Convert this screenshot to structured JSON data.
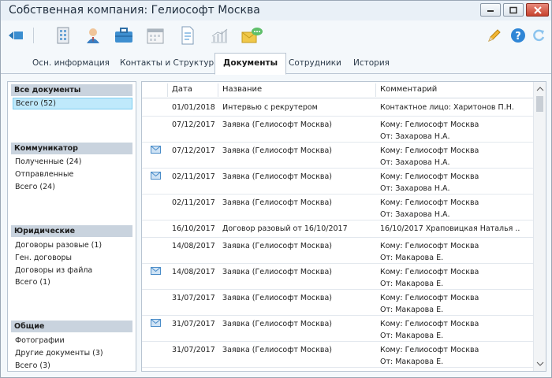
{
  "window": {
    "title": "Собственная компания: Гелиософт Москва"
  },
  "tabs": [
    {
      "label": "Осн. информация"
    },
    {
      "label": "Контакты и Структура"
    },
    {
      "label": "Документы"
    },
    {
      "label": "Сотрудники"
    },
    {
      "label": "История"
    }
  ],
  "active_tab": "Документы",
  "groups": [
    {
      "title": "Все документы",
      "items": [
        "Всего (52)"
      ]
    },
    {
      "title": "Коммуникатор",
      "items": [
        "Полученные (24)",
        "Отправленные",
        "Всего (24)"
      ]
    },
    {
      "title": "Юридические",
      "items": [
        "Договоры разовые (1)",
        "Ген. договоры",
        "Договоры из файла",
        "Всего (1)"
      ]
    },
    {
      "title": "Общие",
      "items": [
        "Фотографии",
        "Другие документы (3)",
        "Всего (3)"
      ]
    }
  ],
  "selected_item": "Всего (52)",
  "table": {
    "columns": [
      "Дата",
      "Название",
      "Комментарий"
    ],
    "rows": [
      {
        "mail": false,
        "date": "01/01/2018",
        "name": "Интервью с рекрутером",
        "comment": [
          "Контактное лицо: Харитонов П.Н."
        ]
      },
      {
        "mail": false,
        "date": "07/12/2017",
        "name": "Заявка (Гелиософт Москва)",
        "comment": [
          "Кому: Гелиософт Москва",
          "От: Захарова Н.А."
        ]
      },
      {
        "mail": true,
        "date": "07/12/2017",
        "name": "Заявка (Гелиософт Москва)",
        "comment": [
          "Кому: Гелиософт Москва",
          "От: Захарова Н.А."
        ]
      },
      {
        "mail": true,
        "date": "02/11/2017",
        "name": "Заявка (Гелиософт Москва)",
        "comment": [
          "Кому: Гелиософт Москва",
          "От: Захарова Н.А."
        ]
      },
      {
        "mail": false,
        "date": "02/11/2017",
        "name": "Заявка (Гелиософт Москва)",
        "comment": [
          "Кому: Гелиософт Москва",
          "От: Захарова Н.А."
        ]
      },
      {
        "mail": false,
        "date": "16/10/2017",
        "name": "Договор разовый от 16/10/2017",
        "comment": [
          "16/10/2017 Храповицкая Наталья ..."
        ]
      },
      {
        "mail": false,
        "date": "14/08/2017",
        "name": "Заявка (Гелиософт Москва)",
        "comment": [
          "Кому: Гелиософт Москва",
          "От: Макарова Е."
        ]
      },
      {
        "mail": true,
        "date": "14/08/2017",
        "name": "Заявка (Гелиософт Москва)",
        "comment": [
          "Кому: Гелиософт Москва",
          "От: Макарова Е."
        ]
      },
      {
        "mail": false,
        "date": "31/07/2017",
        "name": "Заявка (Гелиософт Москва)",
        "comment": [
          "Кому: Гелиософт Москва",
          "От: Макарова Е."
        ]
      },
      {
        "mail": true,
        "date": "31/07/2017",
        "name": "Заявка (Гелиософт Москва)",
        "comment": [
          "Кому: Гелиософт Москва",
          "От: Макарова Е."
        ]
      },
      {
        "mail": false,
        "date": "31/07/2017",
        "name": "Заявка (Гелиософт Москва)",
        "comment": [
          "Кому: Гелиософт Москва",
          "От: Макарова Е."
        ]
      },
      {
        "mail": true,
        "date": "",
        "name": "",
        "comment": []
      }
    ]
  },
  "toolbar_icons": [
    "back-icon",
    "building-icon",
    "person-icon",
    "briefcase-icon",
    "calendar-icon",
    "document-icon",
    "chart-icon",
    "message-icon",
    "pencil-icon",
    "help-icon",
    "refresh-icon"
  ],
  "colors": {
    "selection": "#bfe9fb",
    "group_header": "#c9d3de",
    "accent": "#2f86d6"
  }
}
